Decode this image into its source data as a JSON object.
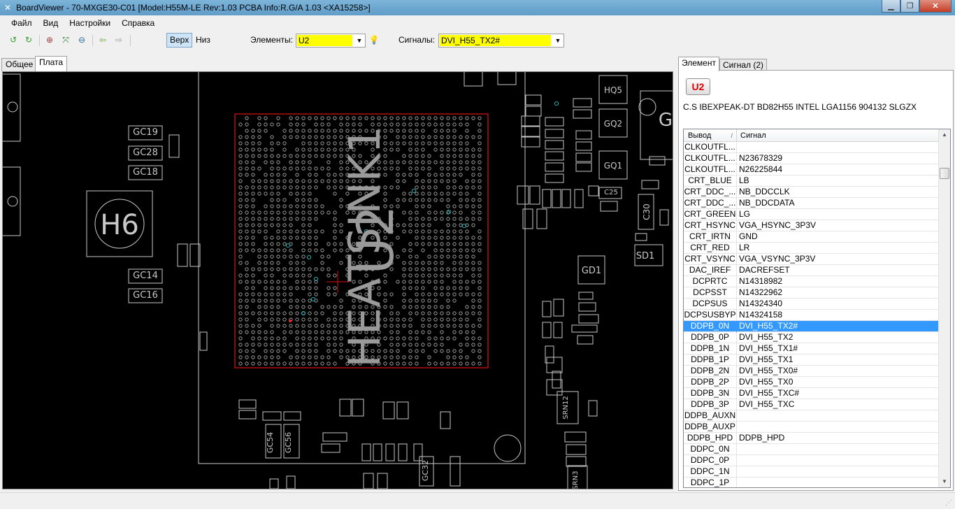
{
  "window": {
    "title": "BoardViewer  -  70-MXGE30-C01 [Model:H55M-LE Rev:1.03 PCBA Info:R.G/A 1.03   <XA15258>]",
    "app_icon": "shuffle-icon"
  },
  "menu": [
    "Файл",
    "Вид",
    "Настройки",
    "Справка"
  ],
  "toolbar": {
    "view_top": "Верх",
    "view_bottom": "Низ",
    "elements_label": "Элементы:",
    "elements_value": "U2",
    "signals_label": "Сигналы:",
    "signals_value": "DVI_H55_TX2#",
    "highlight_color": "#ffff00"
  },
  "left_tabs": [
    "Общее",
    "Плата"
  ],
  "board": {
    "chip_labels": [
      "HEATSINK1",
      "U2"
    ],
    "part_labels": [
      "H6",
      "GC19",
      "GC28",
      "GC18",
      "GC14",
      "GC16",
      "HQ5",
      "GQ2",
      "GQ1",
      "GD1",
      "SD1",
      "C30",
      "C25",
      "SRN12",
      "GC54",
      "GC56",
      "GC32",
      "SRN3",
      "G"
    ],
    "colors": {
      "background": "#000000",
      "outline": "#c8c8c8",
      "chip_highlight": "#e01010",
      "pad_cyan": "#1fa9b0"
    }
  },
  "right_tabs": [
    "Элемент",
    "Сигнал (2)"
  ],
  "element": {
    "name": "U2",
    "description": "C.S IBEXPEAK-DT BD82H55 INTEL LGA1156 904132 SLGZX"
  },
  "pin_table": {
    "columns": [
      "Вывод",
      "Сигнал"
    ],
    "sort_indicator": "/",
    "rows": [
      [
        "CLKOUTFL...",
        ""
      ],
      [
        "CLKOUTFL...",
        "N23678329"
      ],
      [
        "CLKOUTFL...",
        "N26225844"
      ],
      [
        "CRT_BLUE",
        "LB"
      ],
      [
        "CRT_DDC_...",
        "NB_DDCCLK"
      ],
      [
        "CRT_DDC_...",
        "NB_DDCDATA"
      ],
      [
        "CRT_GREEN",
        "LG"
      ],
      [
        "CRT_HSYNC",
        "VGA_HSYNC_3P3V"
      ],
      [
        "CRT_IRTN",
        "GND"
      ],
      [
        "CRT_RED",
        "LR"
      ],
      [
        "CRT_VSYNC",
        "VGA_VSYNC_3P3V"
      ],
      [
        "DAC_IREF",
        "DACREFSET"
      ],
      [
        "DCPRTC",
        "N14318982"
      ],
      [
        "DCPSST",
        "N14322962"
      ],
      [
        "DCPSUS",
        "N14324340"
      ],
      [
        "DCPSUSBYP",
        "N14324158"
      ],
      [
        "DDPB_0N",
        "DVI_H55_TX2#"
      ],
      [
        "DDPB_0P",
        "DVI_H55_TX2"
      ],
      [
        "DDPB_1N",
        "DVI_H55_TX1#"
      ],
      [
        "DDPB_1P",
        "DVI_H55_TX1"
      ],
      [
        "DDPB_2N",
        "DVI_H55_TX0#"
      ],
      [
        "DDPB_2P",
        "DVI_H55_TX0"
      ],
      [
        "DDPB_3N",
        "DVI_H55_TXC#"
      ],
      [
        "DDPB_3P",
        "DVI_H55_TXC"
      ],
      [
        "DDPB_AUXN",
        ""
      ],
      [
        "DDPB_AUXP",
        ""
      ],
      [
        "DDPB_HPD",
        "DDPB_HPD"
      ],
      [
        "DDPC_0N",
        ""
      ],
      [
        "DDPC_0P",
        ""
      ],
      [
        "DDPC_1N",
        ""
      ],
      [
        "DDPC_1P",
        ""
      ]
    ],
    "selected_row": 16
  }
}
